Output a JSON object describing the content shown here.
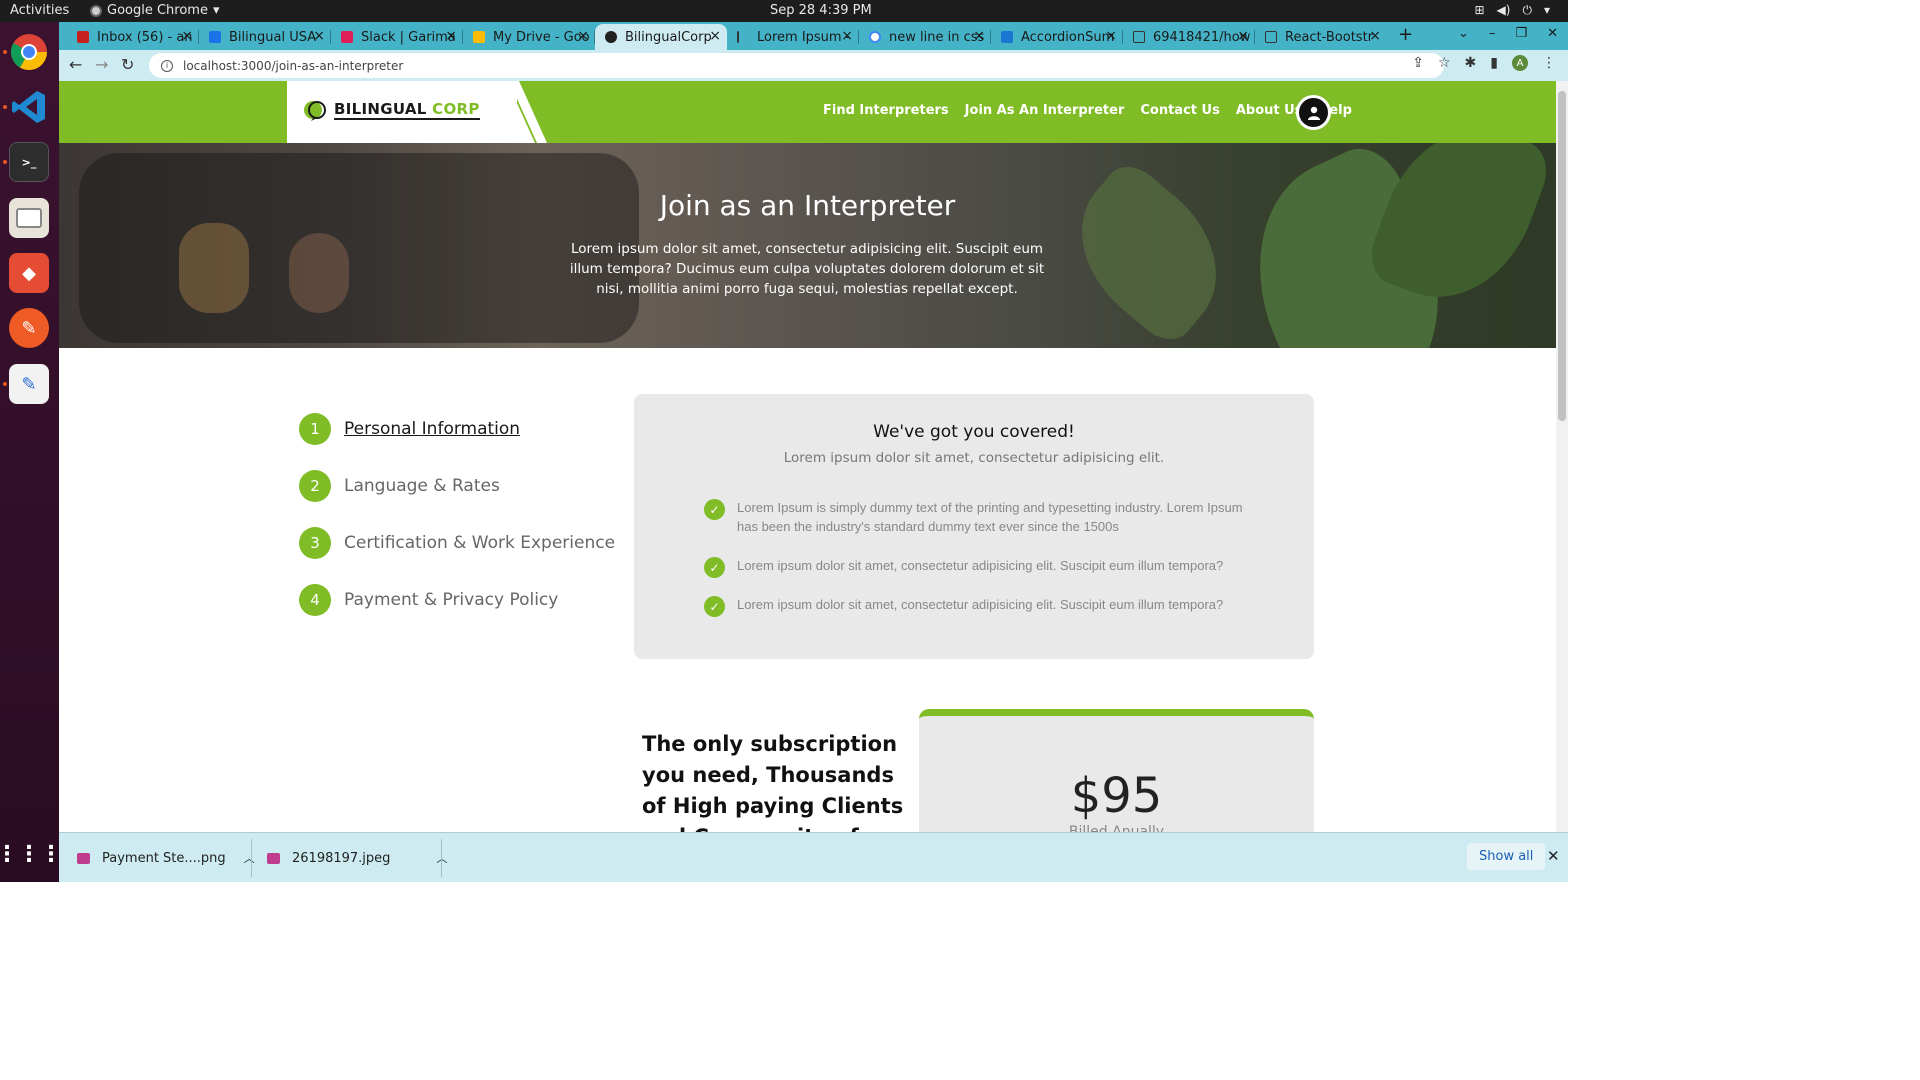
{
  "os": {
    "activities": "Activities",
    "app_name": "Google Chrome",
    "clock": "Sep 28  4:39 PM"
  },
  "browser": {
    "tabs": [
      {
        "title": "Inbox (56) - an",
        "fav": "#c5221f"
      },
      {
        "title": "Bilingual USA",
        "fav": "#1a73e8"
      },
      {
        "title": "Slack | Garima",
        "fav": "#e01e5a"
      },
      {
        "title": "My Drive - Goo",
        "fav": "#fbbc04"
      },
      {
        "title": "BilingualCorp",
        "fav": "#222222"
      },
      {
        "title": "Lorem Ipsum -",
        "fav": "#333333"
      },
      {
        "title": "new line in css",
        "fav": "#4285f4"
      },
      {
        "title": "AccordionSum",
        "fav": "#1976d2"
      },
      {
        "title": "69418421/how",
        "fav": "#444444"
      },
      {
        "title": "React-Bootstr",
        "fav": "#333333"
      }
    ],
    "url": "localhost:3000/join-as-an-interpreter",
    "profile_initial": "A"
  },
  "site": {
    "logo_primary": "BILINGUAL",
    "logo_accent": "CORP",
    "nav": [
      "Find Interpreters",
      "Join As An Interpreter",
      "Contact Us",
      "About Us",
      "Help"
    ],
    "brand_color": "#80bc26"
  },
  "hero": {
    "title": "Join as an Interpreter",
    "text": "Lorem ipsum dolor sit amet, consectetur adipisicing elit. Suscipit eum illum tempora? Ducimus eum culpa voluptates dolorem dolorum et sit nisi, mollitia animi porro fuga sequi, molestias repellat except."
  },
  "steps": [
    {
      "num": "1",
      "label": "Personal Information"
    },
    {
      "num": "2",
      "label": "Language & Rates"
    },
    {
      "num": "3",
      "label": "Certification & Work Experience"
    },
    {
      "num": "4",
      "label": "Payment & Privacy Policy"
    }
  ],
  "covered": {
    "title": "We've got you covered!",
    "subtitle": "Lorem ipsum dolor sit amet, consectetur adipisicing elit.",
    "items": [
      "Lorem Ipsum is simply dummy text of the printing and typesetting industry. Lorem Ipsum has been the industry's standard dummy text ever since the 1500s",
      "Lorem ipsum dolor sit amet, consectetur adipisicing elit. Suscipit eum illum tempora?",
      "Lorem ipsum dolor sit amet, consectetur adipisicing elit. Suscipit eum illum tempora?"
    ]
  },
  "subscription": {
    "heading": "The only subscription you need, Thousands of High paying Clients and Community of Qualit",
    "price": "$95",
    "billing": "Billed Anually"
  },
  "downloads": {
    "items": [
      "Payment Ste....png",
      "26198197.jpeg"
    ],
    "show_all": "Show all"
  }
}
